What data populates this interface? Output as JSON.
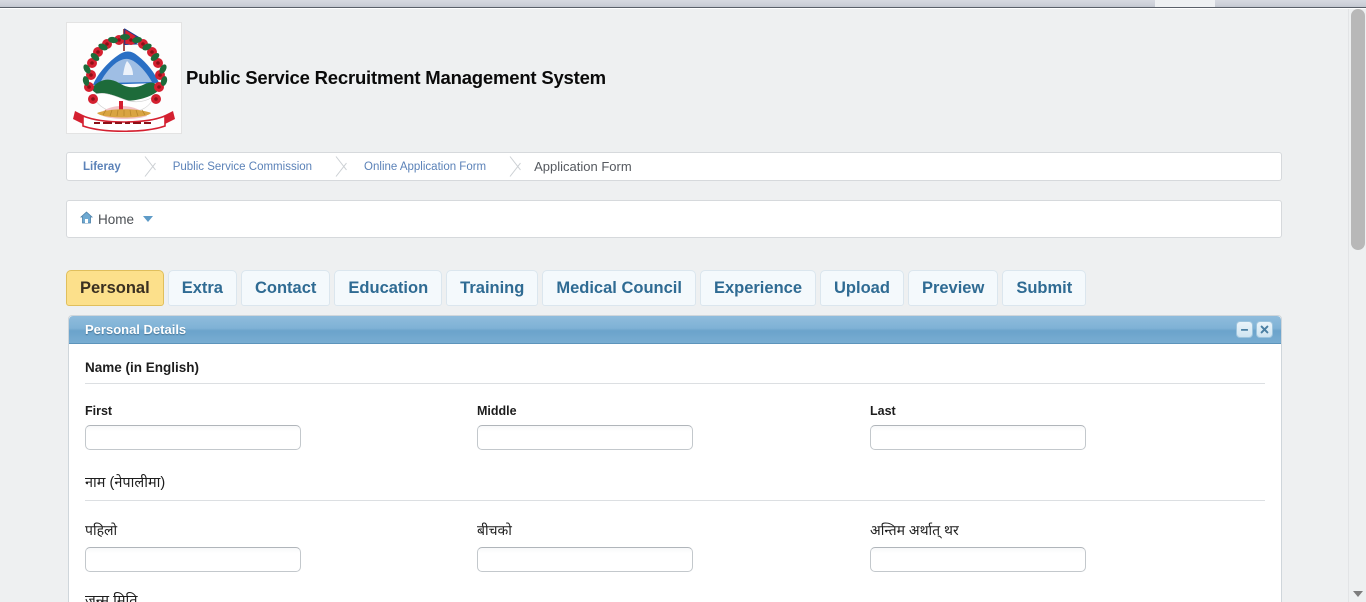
{
  "app": {
    "title": "Public Service Recruitment Management System",
    "emblem_alt": "nepal-coat-of-arms"
  },
  "breadcrumb": {
    "items": [
      {
        "label": "Liferay"
      },
      {
        "label": "Public Service Commission"
      },
      {
        "label": "Online Application Form"
      },
      {
        "label": "Application Form"
      }
    ]
  },
  "navbar": {
    "home_label": "Home"
  },
  "tabs": {
    "items": [
      {
        "label": "Personal",
        "active": true
      },
      {
        "label": "Extra",
        "active": false
      },
      {
        "label": "Contact",
        "active": false
      },
      {
        "label": "Education",
        "active": false
      },
      {
        "label": "Training",
        "active": false
      },
      {
        "label": "Medical Council",
        "active": false
      },
      {
        "label": "Experience",
        "active": false
      },
      {
        "label": "Upload",
        "active": false
      },
      {
        "label": "Preview",
        "active": false
      },
      {
        "label": "Submit",
        "active": false
      }
    ]
  },
  "portlet": {
    "title": "Personal Details",
    "minimize_label": "−",
    "close_label": "✖"
  },
  "form": {
    "section_english": "Name (in English)",
    "section_nepali": "नाम (नेपालीमा)",
    "english_fields": [
      {
        "label": "First",
        "value": "",
        "placeholder": ""
      },
      {
        "label": "Middle",
        "value": "",
        "placeholder": ""
      },
      {
        "label": "Last",
        "value": "",
        "placeholder": ""
      }
    ],
    "nepali_fields": [
      {
        "label": "पहिलो",
        "value": "",
        "placeholder": ""
      },
      {
        "label": "बीचको",
        "value": "",
        "placeholder": ""
      },
      {
        "label": "अन्तिम अर्थात् थर",
        "value": "",
        "placeholder": ""
      }
    ],
    "dob_label": "जन्म मिति"
  },
  "colors": {
    "page_bg": "#eef0f1",
    "tab_active_bg": "#fce08b",
    "tab_inactive_bg": "#f4f9fc",
    "portlet_header": "#7fb2d6",
    "link": "#5b82b8"
  }
}
